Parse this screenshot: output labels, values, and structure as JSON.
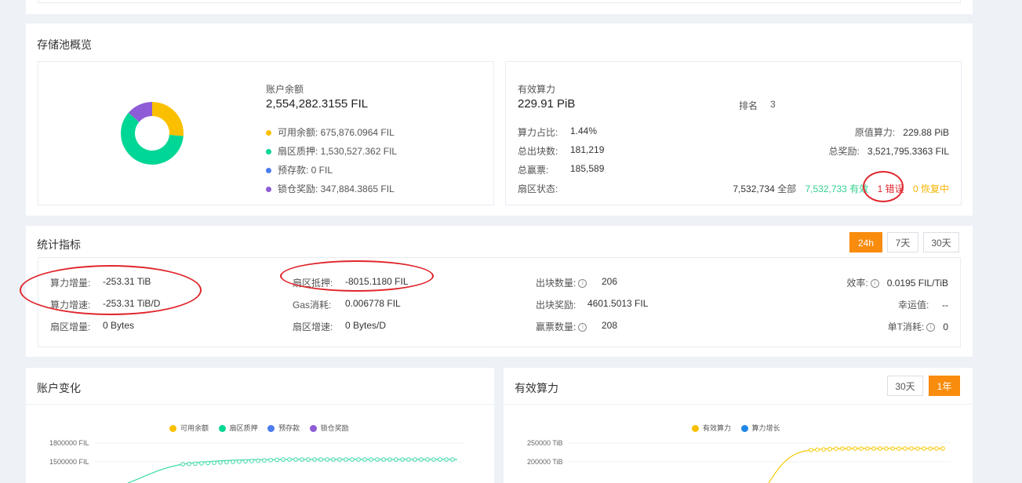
{
  "pool_overview": {
    "title": "存储池概览",
    "balance": {
      "label": "账户余额",
      "value": "2,554,282.3155 FIL",
      "items": [
        {
          "name": "可用余额: 675,876.0964 FIL",
          "color": "#fac000",
          "value": 675876.0964
        },
        {
          "name": "扇区质押: 1,530,527.362 FIL",
          "color": "#00d695",
          "value": 1530527.362
        },
        {
          "name": "预存款: 0 FIL",
          "color": "#4c7cf0",
          "value": 0
        },
        {
          "name": "锁仓奖励: 347,884.3865 FIL",
          "color": "#8e5cd6",
          "value": 347884.3865
        }
      ]
    },
    "power": {
      "label": "有效算力",
      "value": "229.91 PiB",
      "rank_label": "排名",
      "rank_value": "3",
      "share_label": "算力占比:",
      "share_value": "1.44%",
      "raw_label": "原值算力:",
      "raw_value": "229.88 PiB",
      "blocks_label": "总出块数:",
      "blocks_value": "181,219",
      "reward_label": "总奖励:",
      "reward_value": "3,521,795.3363 FIL",
      "tickets_label": "总赢票:",
      "tickets_value": "185,589",
      "sector_label": "扇区状态:",
      "sector_total": "7,532,734",
      "sector_total_label": "全部",
      "sector_active": "7,532,733",
      "sector_active_label": "有效",
      "sector_error": "1",
      "sector_error_label": "错误",
      "sector_recover": "0",
      "sector_recover_label": "恢复中"
    }
  },
  "stats": {
    "title": "统计指标",
    "tabs": [
      "24h",
      "7天",
      "30天"
    ],
    "active_tab": "24h",
    "power_inc_label": "算力增量:",
    "power_inc_value": "-253.31 TiB",
    "power_rate_label": "算力增速:",
    "power_rate_value": "-253.31 TiB/D",
    "sector_inc_label": "扇区增量:",
    "sector_inc_value": "0 Bytes",
    "pledge_label": "扇区抵押:",
    "pledge_value": "-8015.1180 FIL",
    "gas_label": "Gas消耗:",
    "gas_value": "0.006778 FIL",
    "sector_rate_label": "扇区增速:",
    "sector_rate_value": "0 Bytes/D",
    "blocks_label": "出块数量:",
    "blocks_value": "206",
    "block_reward_label": "出块奖励:",
    "block_reward_value": "4601.5013 FIL",
    "tickets_label": "赢票数量:",
    "tickets_value": "208",
    "efficiency_label": "效率:",
    "efficiency_value": "0.0195 FIL/TiB",
    "luck_label": "幸运值:",
    "luck_value": "--",
    "unit_cost_label": "单T消耗:",
    "unit_cost_value": "0"
  },
  "account_change": {
    "title": "账户变化",
    "legend": [
      "可用余额",
      "扇区质押",
      "预存款",
      "锁仓奖励"
    ],
    "legend_colors": [
      "#fac000",
      "#00d695",
      "#4c7cf0",
      "#8e5cd6"
    ],
    "y_ticks": [
      "1800000 FIL",
      "1500000 FIL"
    ]
  },
  "power_chart": {
    "title": "有效算力",
    "tabs": [
      "30天",
      "1年"
    ],
    "active_tab": "1年",
    "legend": [
      "有效算力",
      "算力增长"
    ],
    "legend_colors": [
      "#fac000",
      "#1e88e5"
    ],
    "y_ticks": [
      "250000 TiB",
      "200000 TiB"
    ]
  }
}
